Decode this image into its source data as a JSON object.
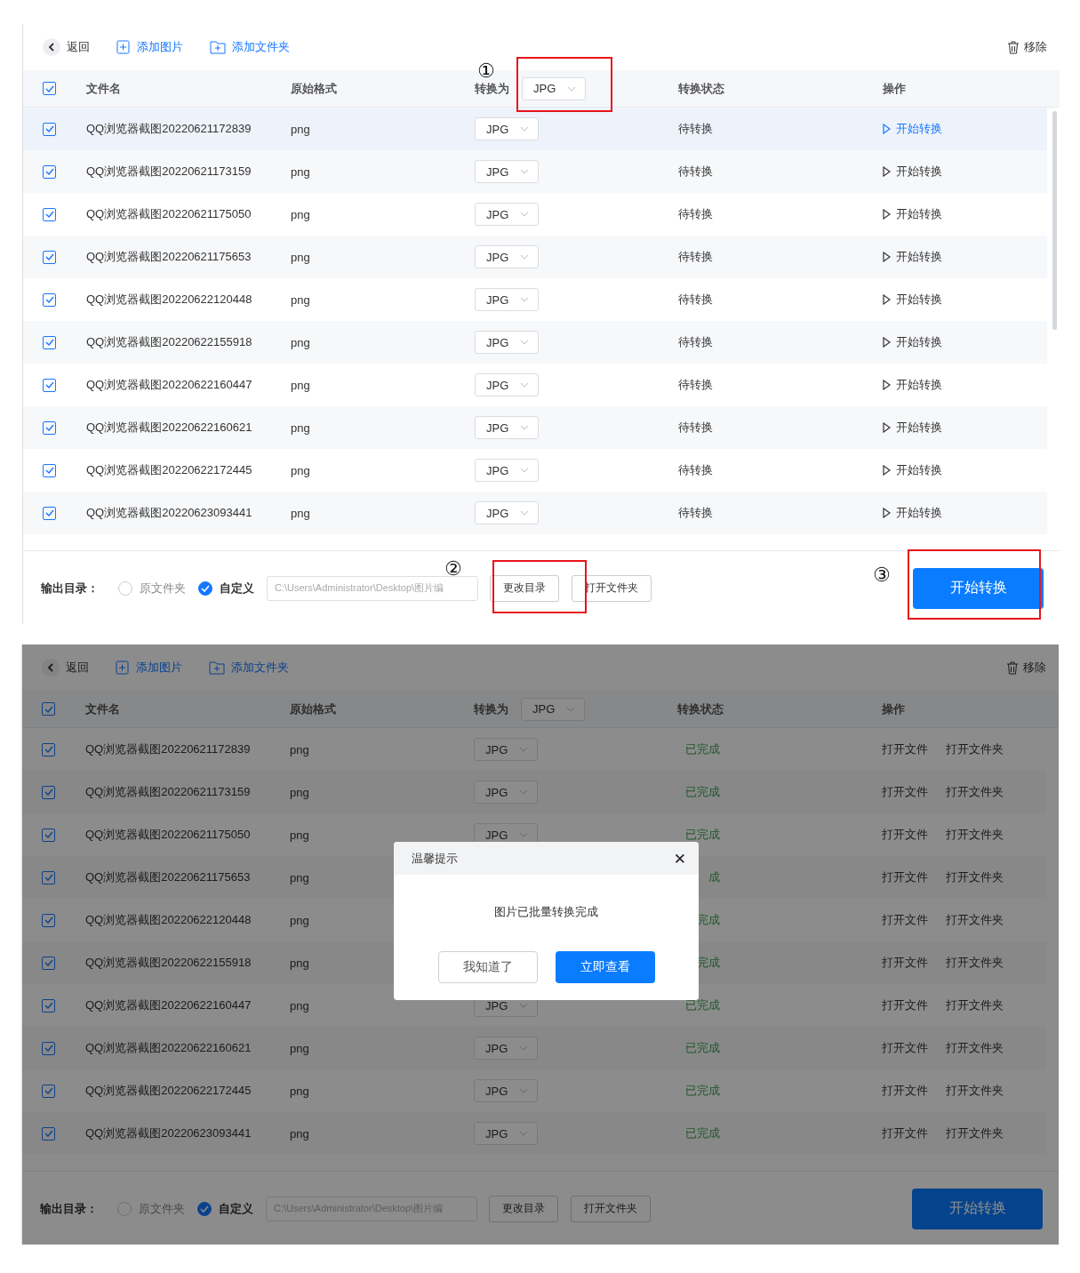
{
  "screens": [
    {
      "dimmed": false,
      "scrollbar": true,
      "toolbar": {
        "back": "返回",
        "add_image": "添加图片",
        "add_folder": "添加文件夹",
        "remove": "移除"
      },
      "columns": {
        "all_checked": true,
        "name": "文件名",
        "source": "原始格式",
        "convert_to": "转换为",
        "convert_select": "JPG",
        "status": "转换状态",
        "action": "操作"
      },
      "rows": [
        {
          "kind": "pending",
          "checked": true,
          "hovered": true,
          "name": "QQ浏览器截图20220621172839",
          "source": "png",
          "format": "JPG",
          "status": "待转换",
          "actions": [
            "开始转换"
          ]
        },
        {
          "kind": "pending",
          "checked": true,
          "hovered": false,
          "name": "QQ浏览器截图20220621173159",
          "source": "png",
          "format": "JPG",
          "status": "待转换",
          "actions": [
            "开始转换"
          ]
        },
        {
          "kind": "pending",
          "checked": true,
          "hovered": false,
          "name": "QQ浏览器截图20220621175050",
          "source": "png",
          "format": "JPG",
          "status": "待转换",
          "actions": [
            "开始转换"
          ]
        },
        {
          "kind": "pending",
          "checked": true,
          "hovered": false,
          "name": "QQ浏览器截图20220621175653",
          "source": "png",
          "format": "JPG",
          "status": "待转换",
          "actions": [
            "开始转换"
          ]
        },
        {
          "kind": "pending",
          "checked": true,
          "hovered": false,
          "name": "QQ浏览器截图20220622120448",
          "source": "png",
          "format": "JPG",
          "status": "待转换",
          "actions": [
            "开始转换"
          ]
        },
        {
          "kind": "pending",
          "checked": true,
          "hovered": false,
          "name": "QQ浏览器截图20220622155918",
          "source": "png",
          "format": "JPG",
          "status": "待转换",
          "actions": [
            "开始转换"
          ]
        },
        {
          "kind": "pending",
          "checked": true,
          "hovered": false,
          "name": "QQ浏览器截图20220622160447",
          "source": "png",
          "format": "JPG",
          "status": "待转换",
          "actions": [
            "开始转换"
          ]
        },
        {
          "kind": "pending",
          "checked": true,
          "hovered": false,
          "name": "QQ浏览器截图20220622160621",
          "source": "png",
          "format": "JPG",
          "status": "待转换",
          "actions": [
            "开始转换"
          ]
        },
        {
          "kind": "pending",
          "checked": true,
          "hovered": false,
          "name": "QQ浏览器截图20220622172445",
          "source": "png",
          "format": "JPG",
          "status": "待转换",
          "actions": [
            "开始转换"
          ]
        },
        {
          "kind": "pending",
          "checked": true,
          "hovered": false,
          "name": "QQ浏览器截图20220623093441",
          "source": "png",
          "format": "JPG",
          "status": "待转换",
          "actions": [
            "开始转换"
          ]
        }
      ],
      "footer": {
        "label": "输出目录：",
        "options": [
          {
            "label": "原文件夹",
            "selected": false
          },
          {
            "label": "自定义",
            "selected": true
          }
        ],
        "path": "C:\\Users\\Administrator\\Desktop\\图片编",
        "change_dir": "更改目录",
        "open_folder": "打开文件夹",
        "start": "开始转换"
      },
      "annotations": [
        {
          "marker": "①"
        },
        {
          "marker": "②"
        },
        {
          "marker": "③"
        }
      ]
    },
    {
      "dimmed": true,
      "scrollbar": false,
      "toolbar": {
        "back": "返回",
        "add_image": "添加图片",
        "add_folder": "添加文件夹",
        "remove": "移除"
      },
      "columns": {
        "all_checked": true,
        "name": "文件名",
        "source": "原始格式",
        "convert_to": "转换为",
        "convert_select": "JPG",
        "status": "转换状态",
        "action": "操作"
      },
      "rows": [
        {
          "kind": "done",
          "checked": true,
          "name": "QQ浏览器截图20220621172839",
          "source": "png",
          "format": "JPG",
          "status": "已完成",
          "actions": [
            "打开文件",
            "打开文件夹"
          ]
        },
        {
          "kind": "done",
          "checked": true,
          "name": "QQ浏览器截图20220621173159",
          "source": "png",
          "format": "JPG",
          "status": "已完成",
          "actions": [
            "打开文件",
            "打开文件夹"
          ]
        },
        {
          "kind": "done",
          "checked": true,
          "name": "QQ浏览器截图20220621175050",
          "source": "png",
          "format": "JPG",
          "status": "已完成",
          "actions": [
            "打开文件",
            "打开文件夹"
          ]
        },
        {
          "kind": "done",
          "checked": true,
          "name": "QQ浏览器截图20220621175653",
          "source": "png",
          "status": "成",
          "actions": [
            "打开文件",
            "打开文件夹"
          ]
        },
        {
          "kind": "done",
          "checked": true,
          "name": "QQ浏览器截图20220622120448",
          "source": "png",
          "status": "完成",
          "actions": [
            "打开文件",
            "打开文件夹"
          ]
        },
        {
          "kind": "done",
          "checked": true,
          "name": "QQ浏览器截图20220622155918",
          "source": "png",
          "status": "完成",
          "actions": [
            "打开文件",
            "打开文件夹"
          ]
        },
        {
          "kind": "done",
          "checked": true,
          "name": "QQ浏览器截图20220622160447",
          "source": "png",
          "format": "JPG",
          "status": "已完成",
          "actions": [
            "打开文件",
            "打开文件夹"
          ]
        },
        {
          "kind": "done",
          "checked": true,
          "name": "QQ浏览器截图20220622160621",
          "source": "png",
          "format": "JPG",
          "status": "已完成",
          "actions": [
            "打开文件",
            "打开文件夹"
          ]
        },
        {
          "kind": "done",
          "checked": true,
          "name": "QQ浏览器截图20220622172445",
          "source": "png",
          "format": "JPG",
          "status": "已完成",
          "actions": [
            "打开文件",
            "打开文件夹"
          ]
        },
        {
          "kind": "done",
          "checked": true,
          "name": "QQ浏览器截图20220623093441",
          "source": "png",
          "format": "JPG",
          "status": "已完成",
          "actions": [
            "打开文件",
            "打开文件夹"
          ]
        }
      ],
      "footer": {
        "label": "输出目录：",
        "options": [
          {
            "label": "原文件夹",
            "selected": false
          },
          {
            "label": "自定义",
            "selected": true
          }
        ],
        "path": "C:\\Users\\Administrator\\Desktop\\图片编",
        "change_dir": "更改目录",
        "open_folder": "打开文件夹",
        "start": "开始转换"
      },
      "dialog": {
        "title": "温馨提示",
        "close": "✕",
        "message": "图片已批量转换完成",
        "buttons": [
          {
            "label": "我知道了",
            "kind": "secondary"
          },
          {
            "label": "立即查看",
            "kind": "primary"
          }
        ]
      }
    }
  ]
}
